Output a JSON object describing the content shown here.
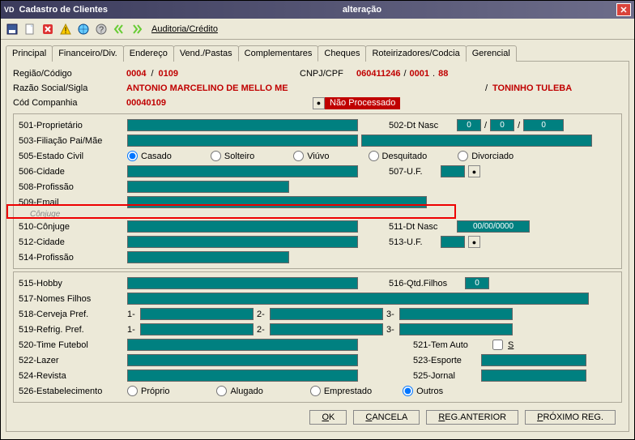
{
  "titlebar": {
    "vd": "VD",
    "title1": "Cadastro de Clientes",
    "title2": "alteração"
  },
  "toolbar": {
    "auditoria": "Auditoria/Crédito"
  },
  "tabs": {
    "principal": "Principal",
    "financeiro": "Financeiro/Div.",
    "endereco": "Endereço",
    "vend": "Vend./Pastas",
    "complementares": "Complementares",
    "cheques": "Cheques",
    "roteirizadores": "Roteirizadores/Codcia",
    "gerencial": "Gerencial"
  },
  "header": {
    "regiao_lbl": "Região/Código",
    "regiao_val1": "0004",
    "sep": "/",
    "regiao_val2": "0109",
    "cnpj_lbl": "CNPJ/CPF",
    "cnpj_val1": "060411246",
    "cnpj_sep": "/",
    "cnpj_val2": "0001",
    "cnpj_dot": ".",
    "cnpj_val3": "88",
    "razao_lbl": "Razão Social/Sigla",
    "razao_val": "ANTONIO MARCELINO DE MELLO ME",
    "razao_sep": "/",
    "sigla": "TONINHO TULEBA",
    "cod_comp_lbl": "Cód Companhia",
    "cod_comp_val": "00040109",
    "status": "Não Processado"
  },
  "fields": {
    "f501": "501-Proprietário",
    "f502": "502-Dt Nasc",
    "dn0": "0",
    "f503": "503-Filiação Pai/Mãe",
    "f505": "505-Estado Civil",
    "ec1": "Casado",
    "ec2": "Solteiro",
    "ec3": "Viúvo",
    "ec4": "Desquitado",
    "ec5": "Divorciado",
    "f506": "506-Cidade",
    "f507": "507-U.F.",
    "f508": "508-Profissão",
    "f509": "509-Email",
    "conjuge": "Cônjuge",
    "f510": "510-Cônjuge",
    "f511": "511-Dt Nasc",
    "dn511": "00/00/0000",
    "f512": "512-Cidade",
    "f513": "513-U.F.",
    "f514": "514-Profissão",
    "f515": "515-Hobby",
    "f516": "516-Qtd.Filhos",
    "qf": "0",
    "f517": "517-Nomes Filhos",
    "f518": "518-Cerveja Pref.",
    "f519": "519-Refrig. Pref.",
    "p1": "1-",
    "p2": "2-",
    "p3": "3-",
    "f520": "520-Time Futebol",
    "f521": "521-Tem Auto",
    "s": "S",
    "f522": "522-Lazer",
    "f523": "523-Esporte",
    "f524": "524-Revista",
    "f525": "525-Jornal",
    "f526": "526-Estabelecimento",
    "est1": "Próprio",
    "est2": "Alugado",
    "est3": "Emprestado",
    "est4": "Outros"
  },
  "buttons": {
    "ok_u": "O",
    "ok": "K",
    "cancela_u": "C",
    "cancela": "ANCELA",
    "reg_u": "R",
    "reg": "EG.ANTERIOR",
    "prox_u": "P",
    "prox": "RÓXIMO REG."
  }
}
